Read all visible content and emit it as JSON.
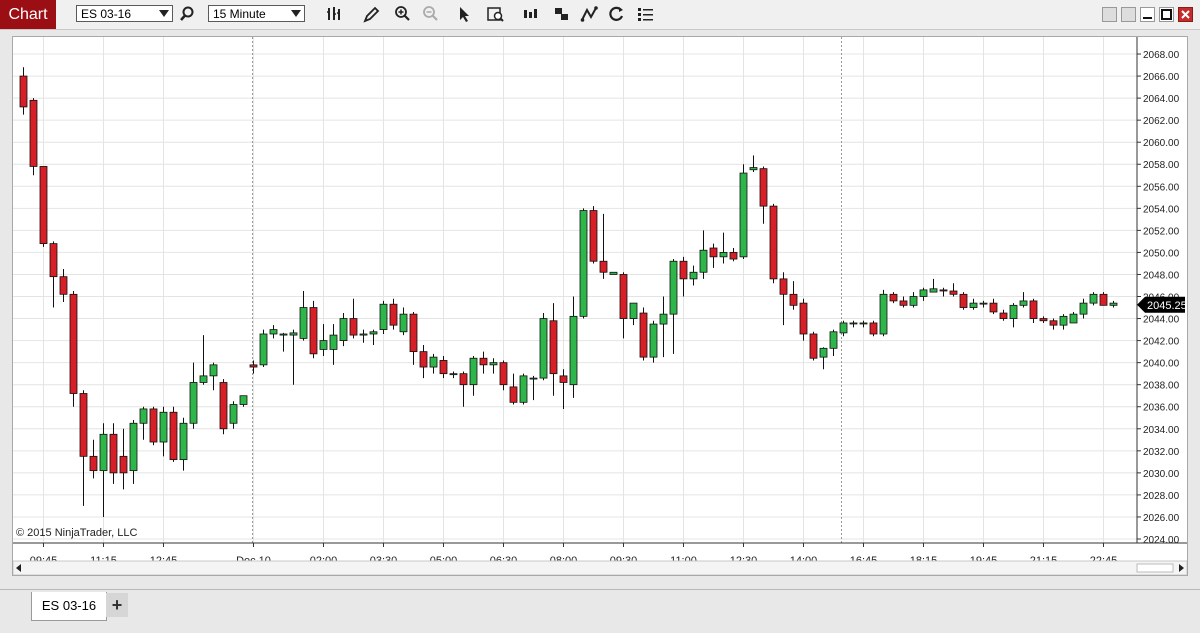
{
  "toolbar": {
    "title": "Chart",
    "instrument": "ES 03-16",
    "interval": "15 Minute",
    "icons": [
      "bars-type-icon",
      "pencil-icon",
      "zoom-in-icon",
      "zoom-out-icon",
      "pointer-icon",
      "data-box-icon",
      "bar-spacing-icon",
      "stack-icon",
      "strategy-icon",
      "reload-icon",
      "properties-icon"
    ]
  },
  "window": {
    "buttons": [
      "restore-down-icon",
      "tile-icon",
      "minimize-icon",
      "maximize-icon",
      "close-icon"
    ]
  },
  "tabs": [
    {
      "label": "ES 03-16"
    }
  ],
  "add_tab_label": "+",
  "copyright": "© 2015 NinjaTrader, LLC",
  "price_marker": "2045.25",
  "colors": {
    "up": "#2fb64a",
    "down": "#d61f26",
    "accent": "#9b0f14"
  },
  "chart_data": {
    "type": "candlestick",
    "instrument": "ES 03-16",
    "interval": "15 Minute",
    "ylim": [
      2024,
      2069
    ],
    "y_ticks": [
      2024,
      2026,
      2028,
      2030,
      2032,
      2034,
      2036,
      2038,
      2040,
      2042,
      2044,
      2046,
      2048,
      2050,
      2052,
      2054,
      2056,
      2058,
      2060,
      2062,
      2064,
      2066,
      2068
    ],
    "y_tick_labels": [
      "2024.00",
      "2026.00",
      "2028.00",
      "2030.00",
      "2032.00",
      "2034.00",
      "2036.00",
      "2038.00",
      "2040.00",
      "2042.00",
      "2044.00",
      "2046.00",
      "2048.00",
      "2050.00",
      "2052.00",
      "2054.00",
      "2056.00",
      "2058.00",
      "2060.00",
      "2062.00",
      "2064.00",
      "2066.00",
      "2068.00"
    ],
    "x_tick_labels": [
      {
        "bar": 2,
        "label": "09:45"
      },
      {
        "bar": 8,
        "label": "11:15"
      },
      {
        "bar": 14,
        "label": "12:45"
      },
      {
        "bar": 23,
        "label": "Dec 10"
      },
      {
        "bar": 30,
        "label": "02:00"
      },
      {
        "bar": 36,
        "label": "03:30"
      },
      {
        "bar": 42,
        "label": "05:00"
      },
      {
        "bar": 48,
        "label": "06:30"
      },
      {
        "bar": 54,
        "label": "08:00"
      },
      {
        "bar": 60,
        "label": "09:30"
      },
      {
        "bar": 66,
        "label": "11:00"
      },
      {
        "bar": 72,
        "label": "12:30"
      },
      {
        "bar": 78,
        "label": "14:00"
      },
      {
        "bar": 84,
        "label": "16:45"
      },
      {
        "bar": 90,
        "label": "18:15"
      },
      {
        "bar": 96,
        "label": "19:45"
      },
      {
        "bar": 102,
        "label": "21:15"
      },
      {
        "bar": 108,
        "label": "22:45"
      }
    ],
    "session_breaks": [
      22.9,
      81.8
    ],
    "last_price": 2045.25,
    "candles": [
      [
        2066.0,
        2066.8,
        2062.5,
        2063.2
      ],
      [
        2063.8,
        2064.0,
        2057.0,
        2057.8
      ],
      [
        2057.8,
        2057.8,
        2050.5,
        2050.8
      ],
      [
        2050.8,
        2051.0,
        2045.0,
        2047.8
      ],
      [
        2047.8,
        2048.5,
        2045.5,
        2046.2
      ],
      [
        2046.2,
        2046.5,
        2036.0,
        2037.2
      ],
      [
        2037.2,
        2037.5,
        2027.0,
        2031.5
      ],
      [
        2031.5,
        2033.0,
        2029.5,
        2030.2
      ],
      [
        2030.2,
        2034.5,
        2026.0,
        2033.5
      ],
      [
        2033.5,
        2034.5,
        2029.0,
        2030.0
      ],
      [
        2031.5,
        2034.0,
        2028.5,
        2030.0
      ],
      [
        2030.2,
        2034.8,
        2029.0,
        2034.5
      ],
      [
        2034.5,
        2036.0,
        2033.0,
        2035.8
      ],
      [
        2035.8,
        2036.0,
        2032.5,
        2032.8
      ],
      [
        2032.8,
        2036.0,
        2031.5,
        2035.5
      ],
      [
        2035.5,
        2036.0,
        2031.0,
        2031.2
      ],
      [
        2031.2,
        2035.0,
        2030.2,
        2034.5
      ],
      [
        2034.5,
        2040.0,
        2034.0,
        2038.2
      ],
      [
        2038.2,
        2042.5,
        2038.0,
        2038.8
      ],
      [
        2038.8,
        2040.0,
        2037.5,
        2039.8
      ],
      [
        2038.2,
        2038.5,
        2033.5,
        2034.0
      ],
      [
        2034.5,
        2036.5,
        2034.0,
        2036.2
      ],
      [
        2036.2,
        2037.0,
        2036.0,
        2037.0
      ],
      [
        2039.8,
        2040.2,
        2039.0,
        2039.6
      ],
      [
        2039.8,
        2043.0,
        2039.6,
        2042.6
      ],
      [
        2042.6,
        2043.4,
        2042.2,
        2043.0
      ],
      [
        2042.5,
        2042.7,
        2041.0,
        2042.6
      ],
      [
        2042.5,
        2043.0,
        2038.0,
        2042.7
      ],
      [
        2042.2,
        2046.5,
        2042.0,
        2045.0
      ],
      [
        2045.0,
        2045.6,
        2040.4,
        2040.8
      ],
      [
        2041.2,
        2043.5,
        2040.6,
        2042.0
      ],
      [
        2041.2,
        2043.5,
        2039.8,
        2042.5
      ],
      [
        2042.0,
        2044.5,
        2041.5,
        2044.0
      ],
      [
        2044.0,
        2045.8,
        2042.2,
        2042.5
      ],
      [
        2042.5,
        2043.0,
        2041.8,
        2042.6
      ],
      [
        2042.6,
        2043.0,
        2041.6,
        2042.8
      ],
      [
        2043.0,
        2045.6,
        2042.6,
        2045.3
      ],
      [
        2045.3,
        2045.8,
        2043.0,
        2043.4
      ],
      [
        2042.8,
        2045.0,
        2042.5,
        2044.4
      ],
      [
        2044.4,
        2044.6,
        2039.8,
        2041.0
      ],
      [
        2041.0,
        2041.6,
        2038.6,
        2039.6
      ],
      [
        2039.6,
        2040.8,
        2039.0,
        2040.5
      ],
      [
        2040.2,
        2040.6,
        2038.6,
        2039.0
      ],
      [
        2039.0,
        2039.2,
        2038.6,
        2039.0
      ],
      [
        2039.0,
        2039.2,
        2036.0,
        2038.0
      ],
      [
        2038.0,
        2040.6,
        2037.0,
        2040.4
      ],
      [
        2040.4,
        2041.0,
        2039.0,
        2039.8
      ],
      [
        2039.8,
        2040.4,
        2039.0,
        2040.0
      ],
      [
        2040.0,
        2040.2,
        2037.5,
        2038.0
      ],
      [
        2037.8,
        2039.0,
        2036.2,
        2036.4
      ],
      [
        2036.4,
        2039.0,
        2036.2,
        2038.8
      ],
      [
        2038.6,
        2038.8,
        2036.6,
        2038.6
      ],
      [
        2038.6,
        2044.5,
        2038.4,
        2044.0
      ],
      [
        2043.8,
        2045.4,
        2037.0,
        2039.0
      ],
      [
        2038.8,
        2039.4,
        2035.8,
        2038.2
      ],
      [
        2038.0,
        2046.0,
        2036.8,
        2044.2
      ],
      [
        2044.2,
        2054.0,
        2044.0,
        2053.8
      ],
      [
        2053.8,
        2054.2,
        2049.0,
        2049.2
      ],
      [
        2049.2,
        2053.5,
        2047.6,
        2048.2
      ],
      [
        2048.0,
        2048.2,
        2048.0,
        2048.2
      ],
      [
        2048.0,
        2048.2,
        2042.2,
        2044.0
      ],
      [
        2044.0,
        2045.4,
        2043.4,
        2045.4
      ],
      [
        2044.5,
        2045.0,
        2040.2,
        2040.5
      ],
      [
        2040.5,
        2043.8,
        2040.0,
        2043.5
      ],
      [
        2043.5,
        2046.0,
        2040.5,
        2044.4
      ],
      [
        2044.4,
        2049.4,
        2040.8,
        2049.2
      ],
      [
        2049.2,
        2049.6,
        2046.0,
        2047.6
      ],
      [
        2047.6,
        2048.8,
        2047.0,
        2048.2
      ],
      [
        2048.2,
        2052.0,
        2047.6,
        2050.2
      ],
      [
        2050.4,
        2050.8,
        2048.6,
        2049.6
      ],
      [
        2049.6,
        2051.8,
        2049.0,
        2050.0
      ],
      [
        2050.0,
        2050.4,
        2049.2,
        2049.4
      ],
      [
        2049.6,
        2058.0,
        2049.4,
        2057.2
      ],
      [
        2057.5,
        2058.8,
        2057.3,
        2057.7
      ],
      [
        2057.6,
        2057.8,
        2052.6,
        2054.2
      ],
      [
        2054.2,
        2054.4,
        2047.2,
        2047.6
      ],
      [
        2047.6,
        2048.2,
        2043.4,
        2046.2
      ],
      [
        2046.2,
        2047.4,
        2044.8,
        2045.2
      ],
      [
        2045.4,
        2045.8,
        2042.0,
        2042.6
      ],
      [
        2042.6,
        2042.8,
        2040.2,
        2040.4
      ],
      [
        2040.5,
        2041.4,
        2039.4,
        2041.3
      ],
      [
        2041.3,
        2043.0,
        2040.6,
        2042.8
      ],
      [
        2042.7,
        2043.8,
        2042.4,
        2043.6
      ],
      [
        2043.6,
        2043.8,
        2043.2,
        2043.6
      ],
      [
        2043.6,
        2043.8,
        2043.2,
        2043.6
      ],
      [
        2043.6,
        2043.8,
        2042.4,
        2042.6
      ],
      [
        2042.6,
        2046.6,
        2042.4,
        2046.2
      ],
      [
        2046.2,
        2046.4,
        2045.4,
        2045.6
      ],
      [
        2045.6,
        2046.0,
        2045.0,
        2045.2
      ],
      [
        2045.2,
        2046.4,
        2045.0,
        2046.0
      ],
      [
        2046.0,
        2046.8,
        2045.6,
        2046.6
      ],
      [
        2046.4,
        2047.6,
        2046.4,
        2046.7
      ],
      [
        2046.6,
        2046.8,
        2046.0,
        2046.5
      ],
      [
        2046.5,
        2047.2,
        2046.0,
        2046.2
      ],
      [
        2046.2,
        2046.4,
        2044.8,
        2045.0
      ],
      [
        2045.0,
        2045.8,
        2044.8,
        2045.4
      ],
      [
        2045.4,
        2045.6,
        2045.0,
        2045.4
      ],
      [
        2045.4,
        2045.8,
        2044.4,
        2044.6
      ],
      [
        2044.5,
        2044.8,
        2043.8,
        2044.0
      ],
      [
        2044.0,
        2045.4,
        2043.2,
        2045.2
      ],
      [
        2045.2,
        2046.4,
        2045.0,
        2045.6
      ],
      [
        2045.6,
        2045.8,
        2043.6,
        2044.0
      ],
      [
        2044.0,
        2044.2,
        2043.6,
        2043.8
      ],
      [
        2043.8,
        2044.0,
        2043.0,
        2043.4
      ],
      [
        2043.4,
        2044.4,
        2043.0,
        2044.2
      ],
      [
        2043.6,
        2044.6,
        2043.6,
        2044.4
      ],
      [
        2044.4,
        2045.8,
        2044.0,
        2045.4
      ],
      [
        2045.4,
        2046.4,
        2045.2,
        2046.2
      ],
      [
        2046.2,
        2046.4,
        2045.2,
        2045.2
      ],
      [
        2045.2,
        2045.6,
        2045.0,
        2045.4
      ]
    ]
  }
}
